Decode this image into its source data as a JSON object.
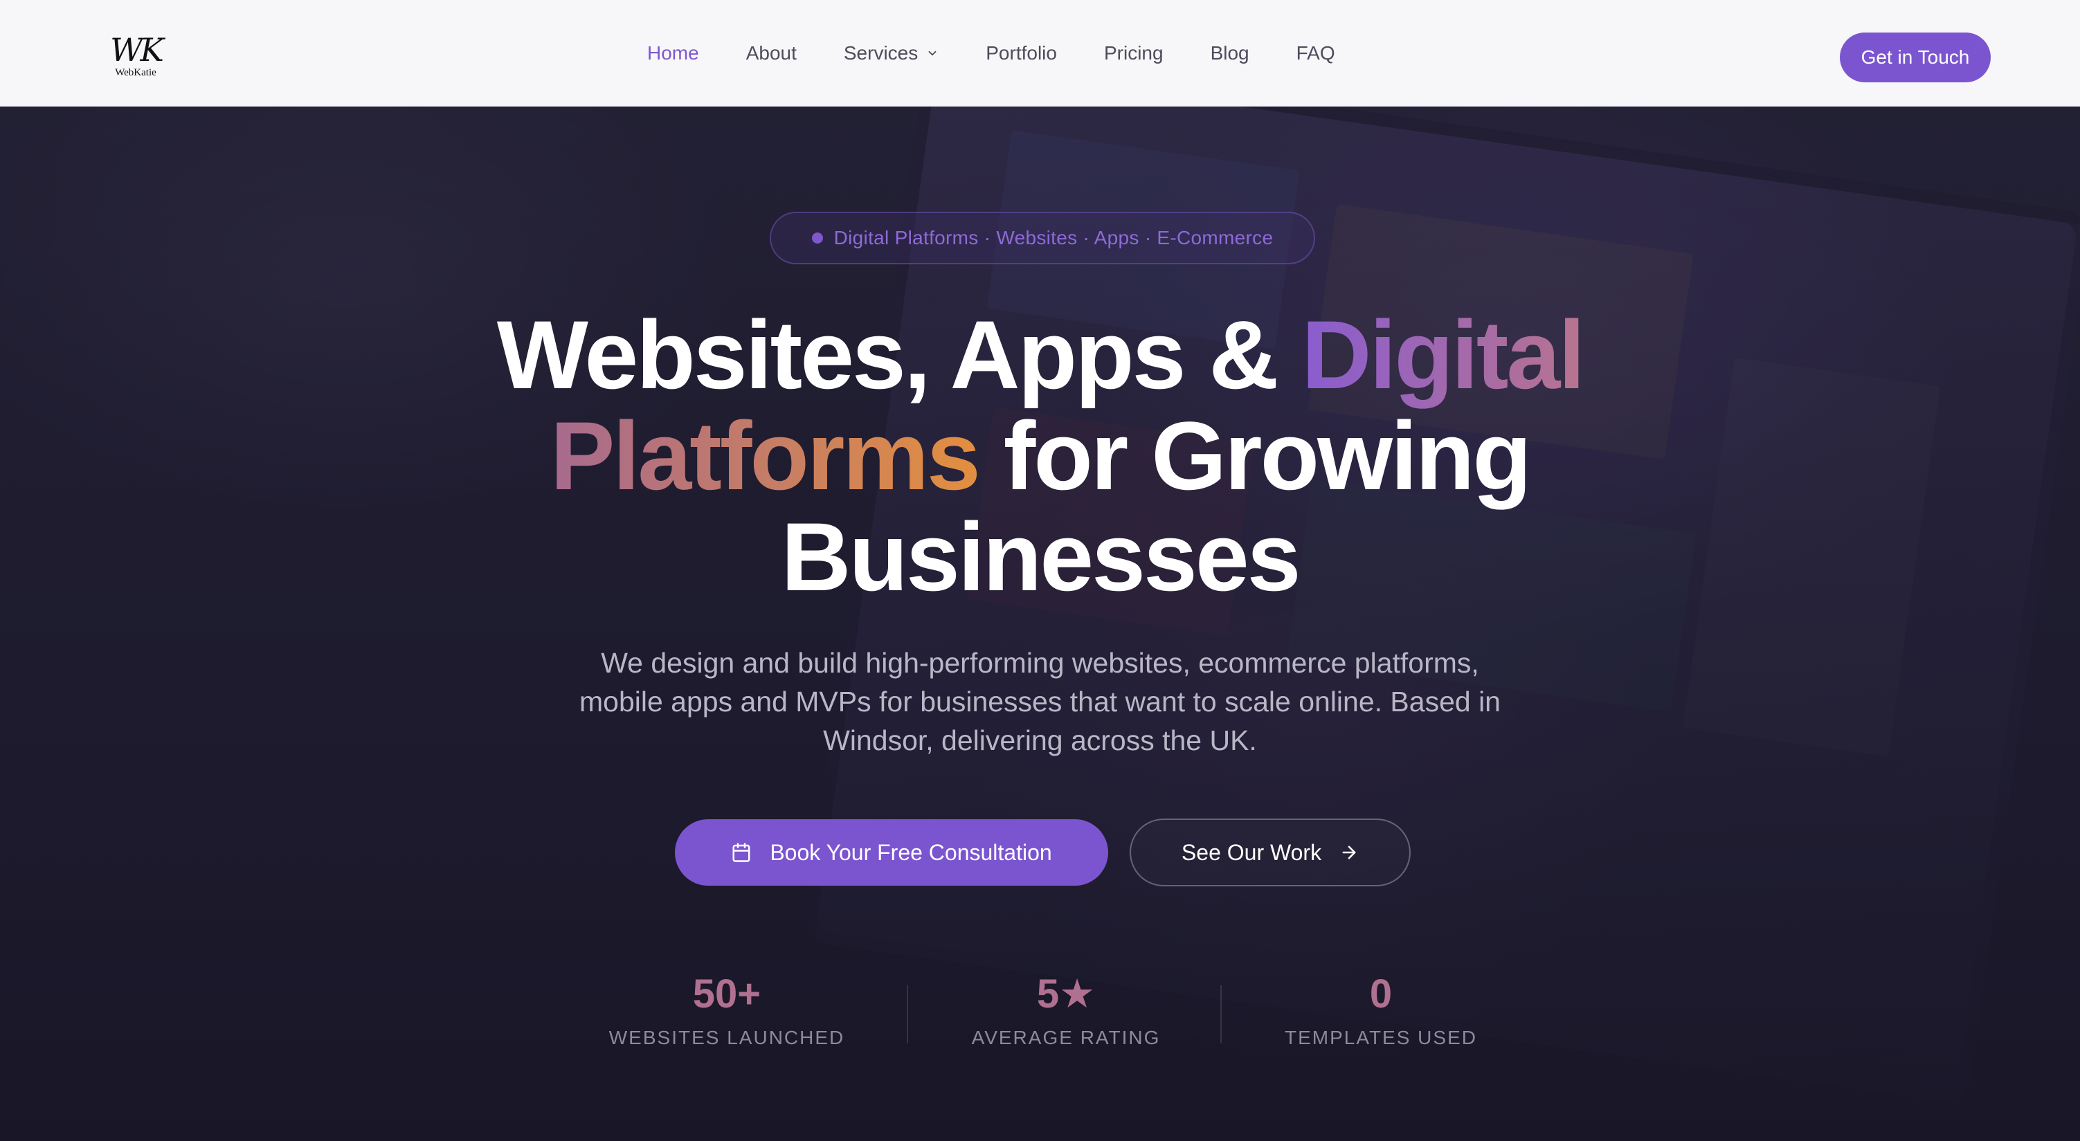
{
  "brand": {
    "logo_mark": "WK",
    "logo_text": "WebKatie"
  },
  "nav": {
    "items": [
      {
        "label": "Home",
        "active": true
      },
      {
        "label": "About"
      },
      {
        "label": "Services",
        "has_dropdown": true
      },
      {
        "label": "Portfolio"
      },
      {
        "label": "Pricing"
      },
      {
        "label": "Blog"
      },
      {
        "label": "FAQ"
      }
    ],
    "cta_label": "Get in Touch"
  },
  "hero": {
    "badge": "Digital Platforms · Websites · Apps · E-Commerce",
    "headline": {
      "part1": "Websites, Apps & ",
      "highlight1": "Digital",
      "highlight2": "Platforms",
      "part2": " for Growing Businesses"
    },
    "subtitle": "We design and build high-performing websites, ecommerce platforms, mobile apps and MVPs for businesses that want to scale online. Based in Windsor, delivering across the UK.",
    "primary_button": {
      "label": "Book Your Free Consultation",
      "icon": "calendar-icon"
    },
    "secondary_button": {
      "label": "See Our Work",
      "icon": "arrow-right-icon"
    }
  },
  "stats": [
    {
      "value": "50+",
      "label": "WEBSITES LAUNCHED"
    },
    {
      "value": "5★",
      "label": "AVERAGE RATING"
    },
    {
      "value": "0",
      "label": "TEMPLATES USED"
    }
  ],
  "colors": {
    "accent": "#7b55cf",
    "header_bg": "#f7f7f9",
    "hero_bg": "#242136",
    "stat_value": "#b07090"
  }
}
